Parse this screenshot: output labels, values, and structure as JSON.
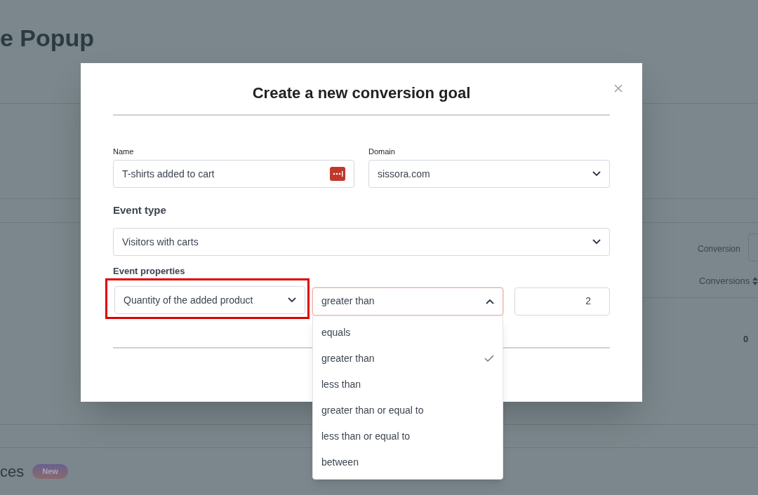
{
  "background_page": {
    "title": "e Popup",
    "conversion_label": "Conversion",
    "column_header": "Conversions",
    "cell_value": "0",
    "section_title": "ces",
    "badge": "New"
  },
  "dialog": {
    "title": "Create a new conversion goal",
    "name_label": "Name",
    "name_value": "T-shirts added to cart",
    "domain_label": "Domain",
    "domain_value": "sissora.com",
    "event_type_heading": "Event type",
    "event_type_value": "Visitors with carts",
    "event_properties_label": "Event properties",
    "property": {
      "value": "Quantity of the added product",
      "highlighted": true
    },
    "operator": {
      "value": "greater than",
      "expanded": true
    },
    "amount": "2",
    "operator_options": [
      {
        "label": "equals",
        "selected": false
      },
      {
        "label": "greater than",
        "selected": true
      },
      {
        "label": "less than",
        "selected": false
      },
      {
        "label": "greater than or equal to",
        "selected": false
      },
      {
        "label": "less than or equal to",
        "selected": false
      },
      {
        "label": "between",
        "selected": false
      }
    ]
  }
}
